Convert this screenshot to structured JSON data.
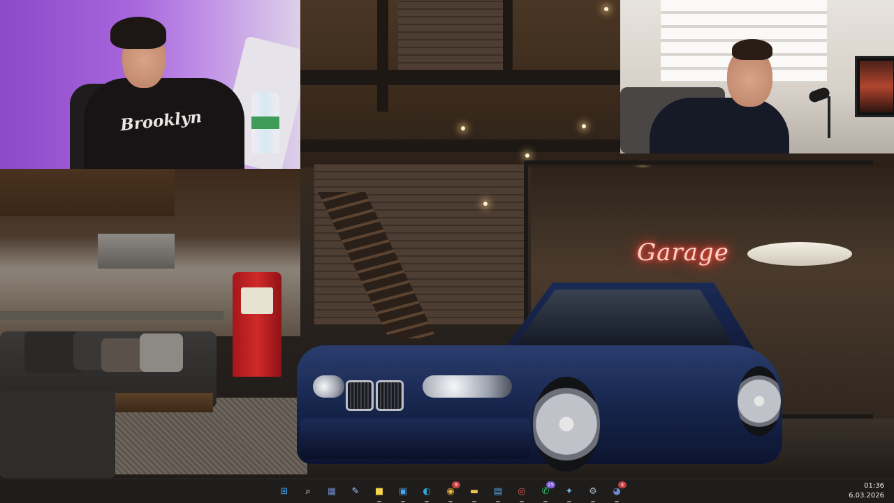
{
  "wallpaper": {
    "neon_sign": "Garage",
    "tshirt_text": "Brooklyn"
  },
  "webcams": {
    "left": {
      "description_icon": "webcam-feed"
    },
    "right": {
      "description_icon": "webcam-feed"
    }
  },
  "taskbar": {
    "icons": [
      {
        "name": "start-icon",
        "glyph": "⊞",
        "color": "#3aa0f2"
      },
      {
        "name": "search-icon",
        "glyph": "⌕",
        "color": "#ffffff"
      },
      {
        "name": "calculator-icon",
        "glyph": "▦",
        "color": "#6b86c4"
      },
      {
        "name": "notepad-icon",
        "glyph": "✎",
        "color": "#9fc3ff"
      },
      {
        "name": "sticky-notes-icon",
        "glyph": "■",
        "color": "#f6d64a"
      },
      {
        "name": "store-icon",
        "glyph": "▣",
        "color": "#4aa3e6"
      },
      {
        "name": "edge-icon",
        "glyph": "◐",
        "color": "#2fa6d8"
      },
      {
        "name": "chrome-icon",
        "glyph": "◉",
        "color": "#e8b23a",
        "badge": "9"
      },
      {
        "name": "file-explorer-icon",
        "glyph": "▬",
        "color": "#f2c14b"
      },
      {
        "name": "notes-icon",
        "glyph": "▤",
        "color": "#59a7e8"
      },
      {
        "name": "capture-icon",
        "glyph": "◎",
        "color": "#e35a5a"
      },
      {
        "name": "whatsapp-icon",
        "glyph": "✆",
        "color": "#27c96b",
        "badge": "25"
      },
      {
        "name": "app-icon",
        "glyph": "✦",
        "color": "#6db6e6"
      },
      {
        "name": "settings-icon",
        "glyph": "⚙",
        "color": "#a7b3c4"
      },
      {
        "name": "discord-icon",
        "glyph": "◕",
        "color": "#7289da",
        "badge": "4"
      }
    ],
    "clock": {
      "time": "01:36",
      "date": "6.03.2026"
    }
  }
}
